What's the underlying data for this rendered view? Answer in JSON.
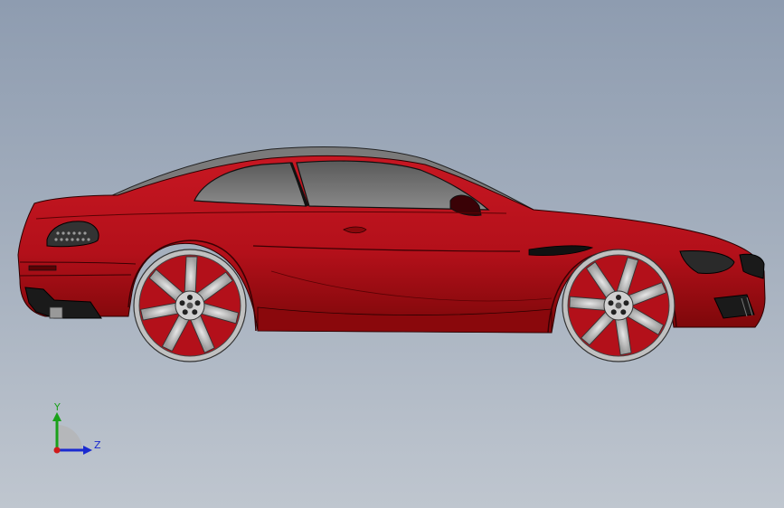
{
  "viewport": {
    "background_top": "#8e9cb0",
    "background_bottom": "#bfc6cf"
  },
  "model": {
    "body_color": "#b3101a",
    "body_shadow": "#6e0609",
    "glass_color": "#6f6f6f",
    "rim_color": "#c8c8c8",
    "tire_color": "#2a2a2a"
  },
  "triad": {
    "y_label": "Y",
    "z_label": "Z",
    "y_color": "#1aa11a",
    "z_color": "#1a2ad0",
    "x_color": "#d01a1a"
  }
}
